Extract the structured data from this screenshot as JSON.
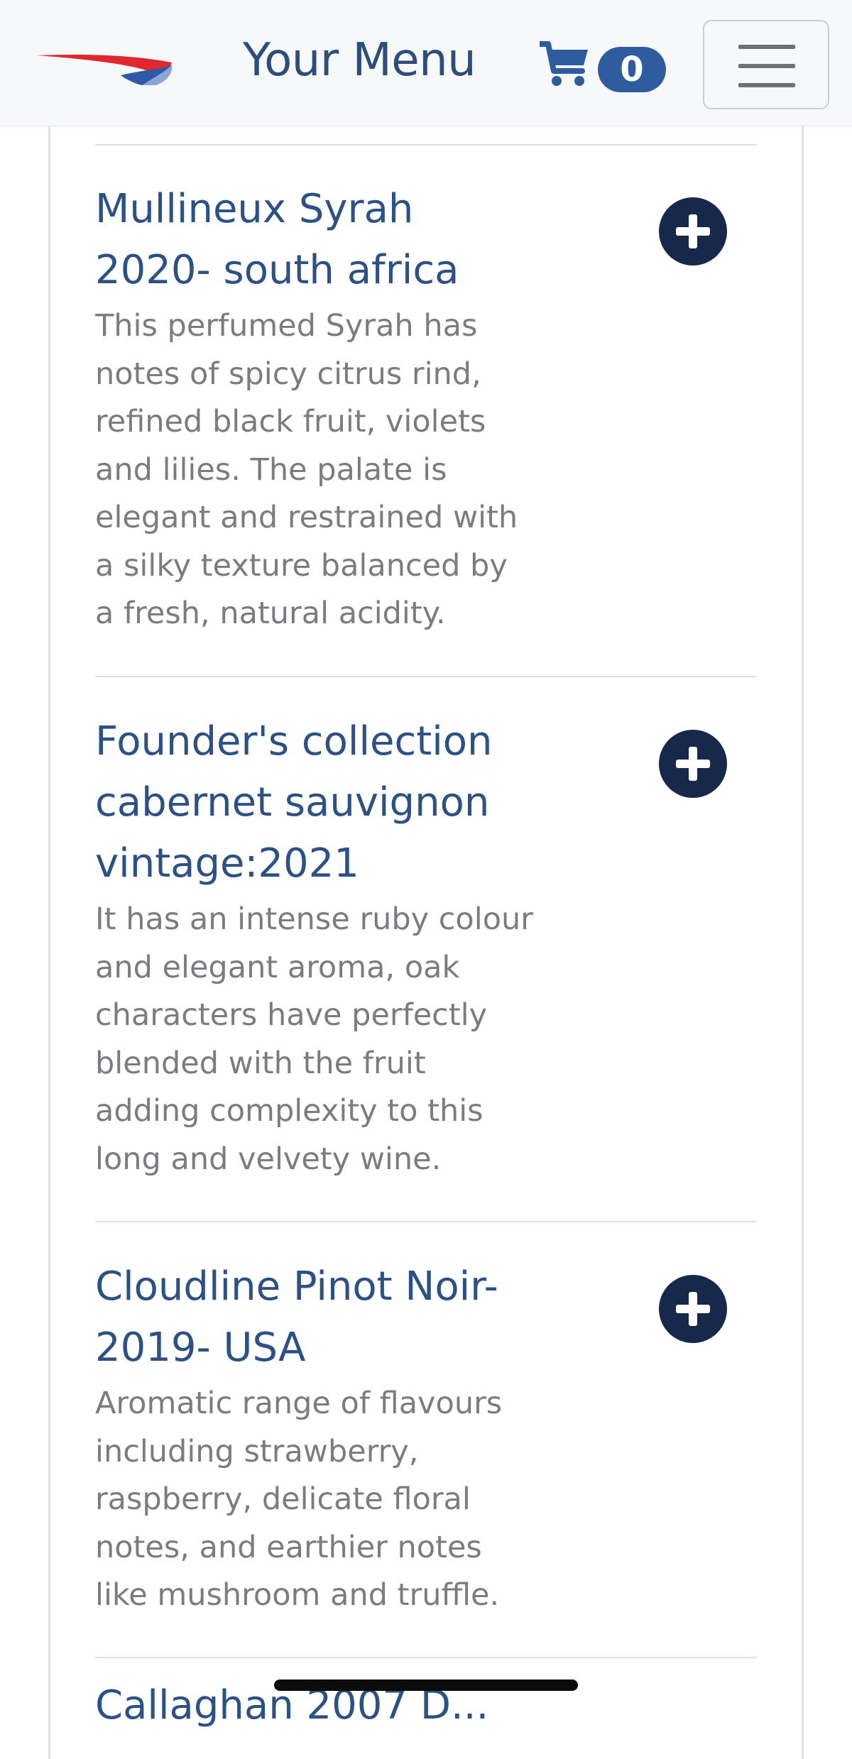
{
  "header": {
    "title": "Your Menu",
    "logo_icon": "airline-speedmarque-logo",
    "cart_icon": "shopping-cart-icon",
    "cart_count": "0",
    "menu_icon": "hamburger-menu-icon"
  },
  "items": [
    {
      "title": "Mullineux Syrah 2020- south africa",
      "description": "This perfumed Syrah has notes of spicy citrus rind, refined black fruit, violets and lilies. The palate is elegant and restrained with a silky texture balanced by a fresh, natural acidity.",
      "action_icon": "plus-circle-icon"
    },
    {
      "title": "Founder's collection cabernet sauvignon vintage:2021",
      "description": "It has an intense ruby colour and elegant aroma, oak characters have perfectly blended with the fruit adding complexity to this long and velvety wine.",
      "action_icon": "plus-circle-icon"
    },
    {
      "title": "Cloudline Pinot Noir- 2019- USA",
      "description": "Aromatic range of flavours including strawberry, raspberry, delicate floral notes, and earthier notes like mushroom and truffle.",
      "action_icon": "plus-circle-icon"
    }
  ],
  "next_item_partial_title": "Callaghan 2007 D...",
  "colors": {
    "header_bg": "#f7f8fa",
    "title_blue": "#2c5185",
    "description_gray": "#7a7c80",
    "add_button": "#16294a",
    "badge_blue": "#2e5c9e"
  }
}
